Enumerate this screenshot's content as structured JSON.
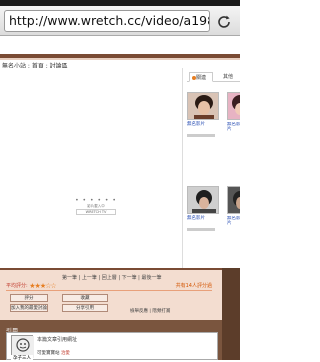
{
  "browser": {
    "url": "http://www.wretch.cc/video/a1984..."
  },
  "page": {
    "breadcrumb": "無名小站 : 首頁 : 討論區",
    "loader": {
      "dots": "• • • • • •",
      "text": "影片載入中",
      "logo": "WRETCH TV"
    },
    "sidebar": {
      "tab_related": "關連",
      "tab_other": "其他",
      "thumbs": [
        {
          "caption": "無名影片"
        },
        {
          "caption": "無名影片"
        },
        {
          "caption": "無名影片"
        },
        {
          "caption": "無名影片"
        }
      ]
    },
    "pager": "第一筆 | 上一筆 | 回上層 | 下一筆 | 最後一筆",
    "rating": {
      "label": "平均評分:",
      "stars": "★★★☆☆",
      "count": "共有14人評分過"
    },
    "buttons": {
      "rate": "評分",
      "favorite": "收藏",
      "add": "加入我的最愛討論",
      "share": "分享引用"
    },
    "small_links": "檢舉反應 | 階頻打賞",
    "citation": {
      "label": "引用",
      "title": "本篇文章引用網址",
      "avatar_label": "孕子三人",
      "link_text": "可愛寶寶站",
      "link_tail": "治愛"
    }
  }
}
